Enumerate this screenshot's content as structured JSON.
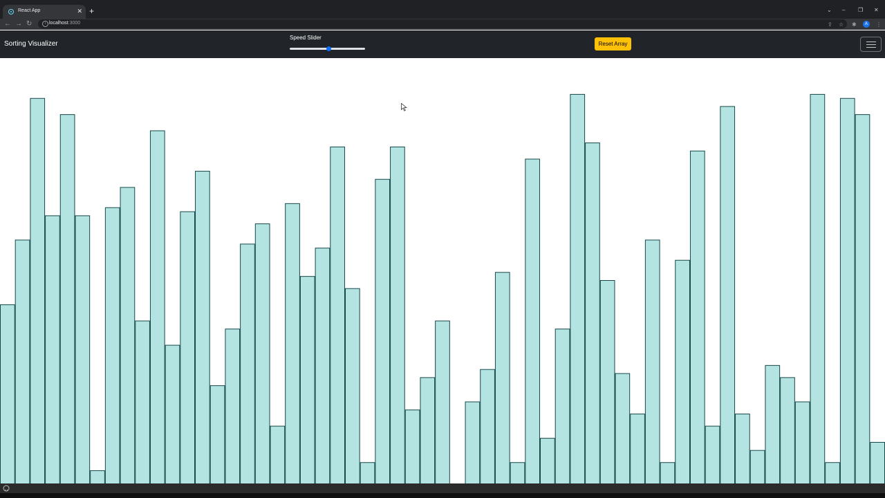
{
  "browser": {
    "tab_title": "React App",
    "url_host": "localhost",
    "url_port": ":3000",
    "profile_initial": "A"
  },
  "app": {
    "brand": "Sorting Visualizer",
    "slider_label": "Speed Slider",
    "speed_value": 0.52,
    "reset_label": "Reset Array"
  },
  "colors": {
    "bar_fill": "#b3e4e1",
    "bar_stroke": "#15474a",
    "navbar": "#212529",
    "reset_button": "#ffc107",
    "slider_thumb": "#0d6efd"
  },
  "chart_data": {
    "type": "bar",
    "ylim": [
      0,
      100
    ],
    "values": [
      44,
      60,
      95,
      66,
      91,
      66,
      3,
      68,
      73,
      40,
      87,
      34,
      67,
      77,
      24,
      38,
      59,
      64,
      14,
      69,
      51,
      58,
      83,
      48,
      5,
      75,
      83,
      18,
      26,
      40,
      0,
      20,
      28,
      52,
      5,
      80,
      11,
      38,
      96,
      84,
      50,
      27,
      17,
      60,
      5,
      55,
      82,
      14,
      93,
      17,
      8,
      29,
      26,
      20,
      96,
      5,
      95,
      91,
      10
    ]
  }
}
